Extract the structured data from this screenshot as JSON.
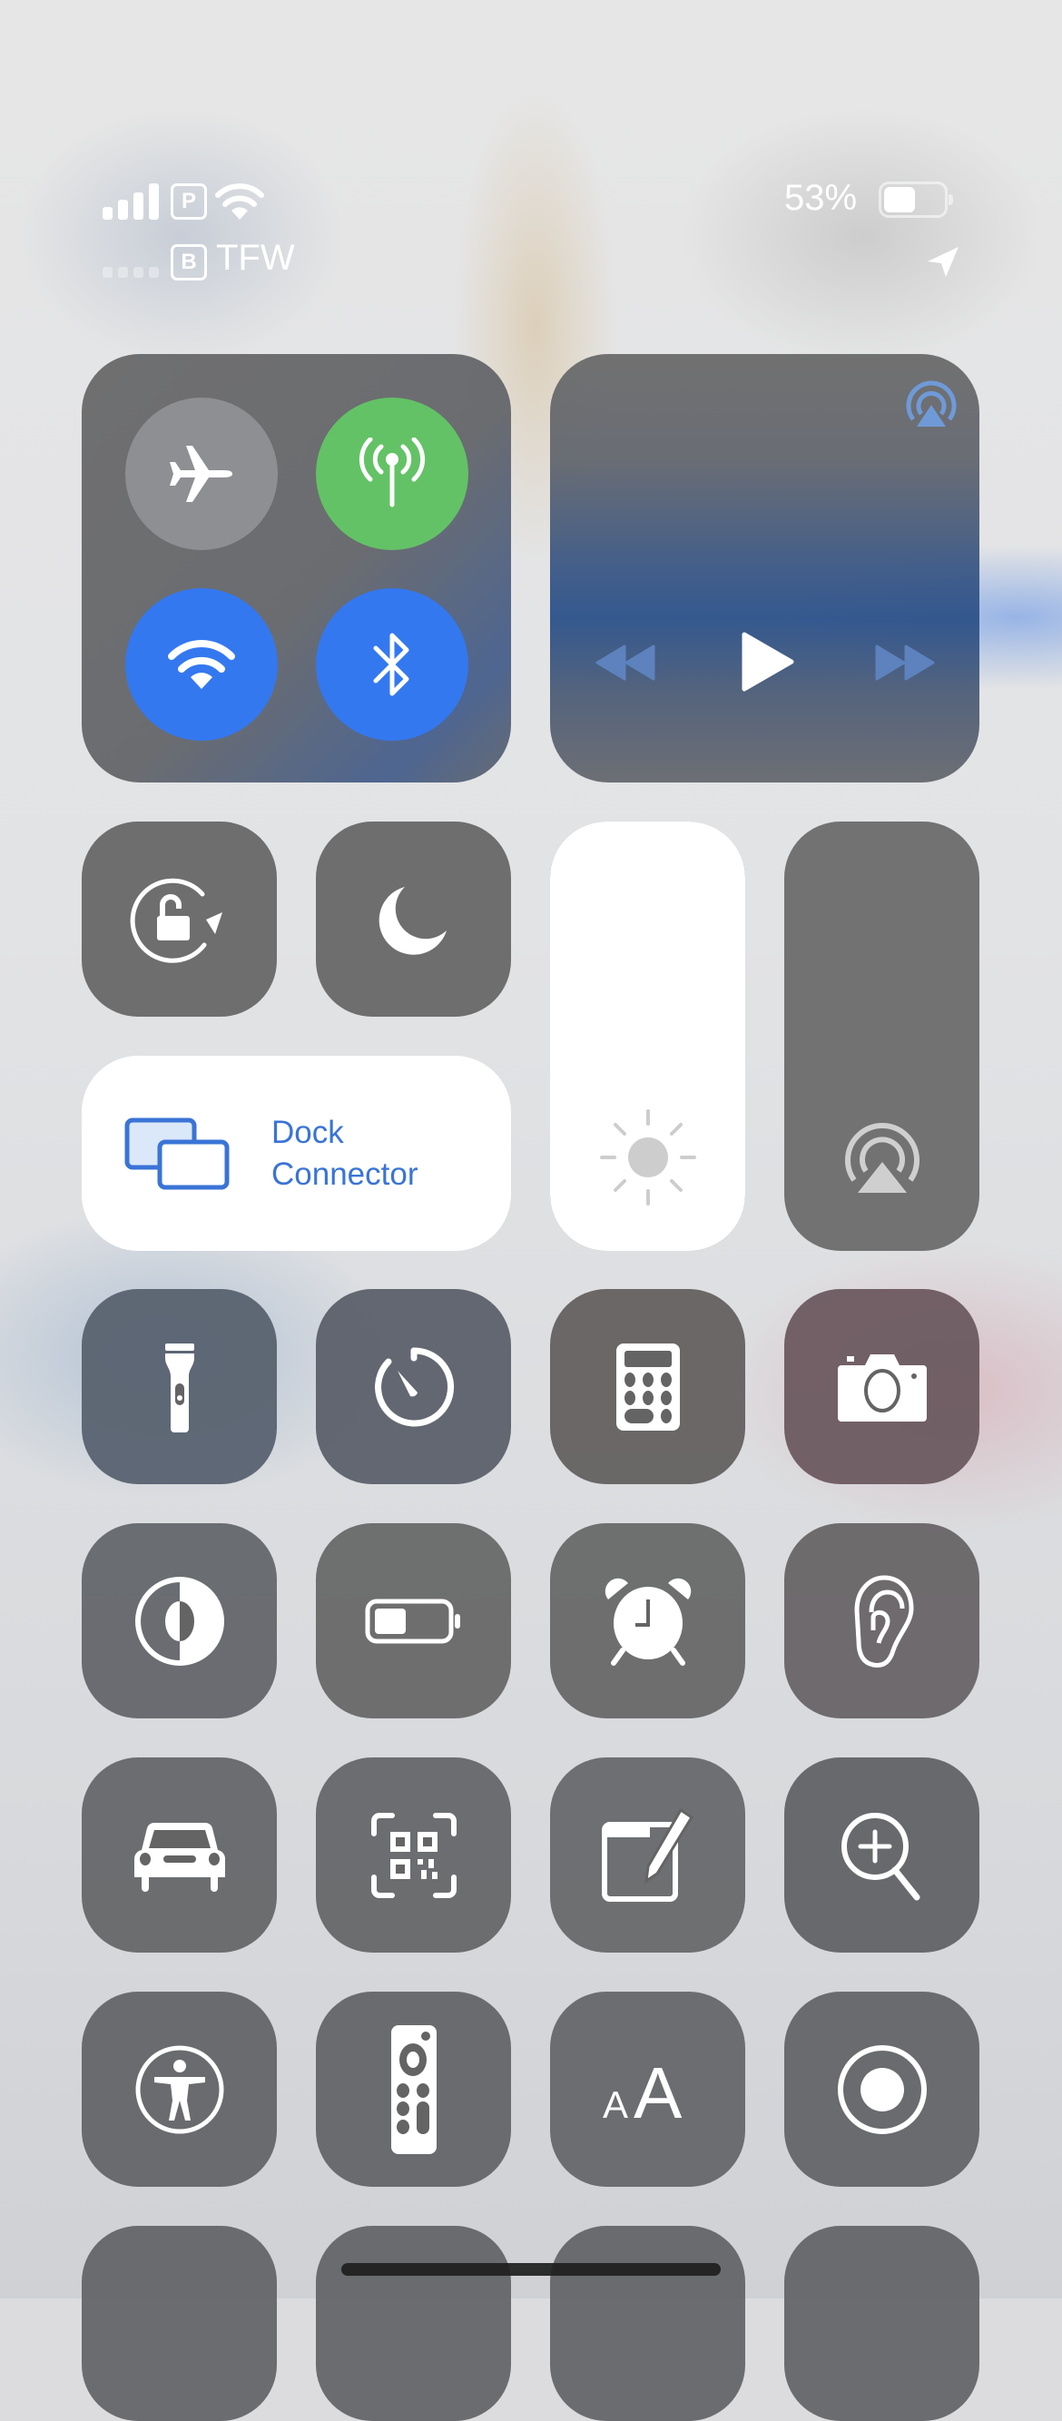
{
  "status_bar": {
    "carrier_primary_badge": "P",
    "carrier_secondary_badge": "B",
    "carrier_secondary_name": "TFW",
    "battery_percent": "53%",
    "battery_level": 0.53,
    "icons": [
      "cellular-signal-icon",
      "wifi-icon",
      "cellular-signal-secondary-icon",
      "location-arrow-icon",
      "battery-icon"
    ]
  },
  "connectivity": {
    "airplane_mode": {
      "icon": "airplane-icon",
      "state": "off",
      "color": "#8e8f92"
    },
    "cellular_data": {
      "icon": "antenna-icon",
      "state": "on",
      "color": "#63c266"
    },
    "wifi": {
      "icon": "wifi-icon",
      "state": "on",
      "color": "#3478f0"
    },
    "bluetooth": {
      "icon": "bluetooth-icon",
      "state": "on",
      "color": "#3478f0"
    }
  },
  "now_playing": {
    "airplay_icon": "airplay-audio-icon",
    "controls": [
      "rewind-icon",
      "play-icon",
      "fast-forward-icon"
    ],
    "accent": "#6f9ad8"
  },
  "toggles": {
    "orientation_lock": {
      "icon": "rotation-lock-icon",
      "state": "off"
    },
    "do_not_disturb": {
      "icon": "moon-icon",
      "state": "off"
    }
  },
  "screen_mirroring": {
    "label_line1": "Dock",
    "label_line2": "Connector",
    "accent": "#3a74d6"
  },
  "sliders": {
    "brightness": {
      "icon": "sun-icon",
      "level": 1.0
    },
    "volume": {
      "icon": "airplay-audio-icon",
      "level": 0.0
    }
  },
  "grid": [
    {
      "name": "flashlight",
      "icon": "flashlight-icon"
    },
    {
      "name": "timer",
      "icon": "timer-icon"
    },
    {
      "name": "calculator",
      "icon": "calculator-icon"
    },
    {
      "name": "camera",
      "icon": "camera-icon"
    },
    {
      "name": "dark-mode",
      "icon": "dark-mode-icon"
    },
    {
      "name": "low-power-mode",
      "icon": "battery-icon"
    },
    {
      "name": "alarm",
      "icon": "alarm-clock-icon"
    },
    {
      "name": "hearing",
      "icon": "ear-icon"
    },
    {
      "name": "driving-focus",
      "icon": "car-icon"
    },
    {
      "name": "code-scanner",
      "icon": "qr-code-icon"
    },
    {
      "name": "quick-note",
      "icon": "note-pencil-icon"
    },
    {
      "name": "magnifier",
      "icon": "magnifier-icon"
    },
    {
      "name": "accessibility-shortcut",
      "icon": "accessibility-icon"
    },
    {
      "name": "apple-tv-remote",
      "icon": "tv-remote-icon"
    },
    {
      "name": "text-size",
      "icon": "text-size-icon",
      "glyph_small": "A",
      "glyph_large": "A"
    },
    {
      "name": "screen-recording",
      "icon": "record-icon"
    }
  ]
}
